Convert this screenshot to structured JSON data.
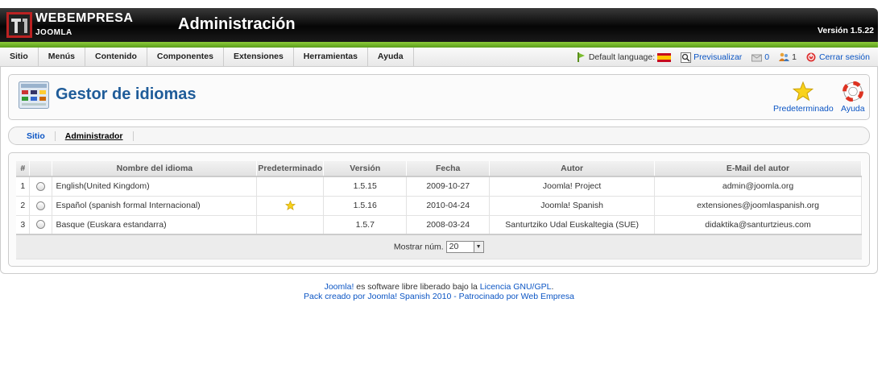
{
  "header": {
    "logo_title": "WEBEMPRESA",
    "logo_sub": "JOOMLA",
    "title": "Administración",
    "version": "Versión 1.5.22"
  },
  "menu": [
    "Sitio",
    "Menús",
    "Contenido",
    "Componentes",
    "Extensiones",
    "Herramientas",
    "Ayuda"
  ],
  "status": {
    "default_language": "Default language:",
    "preview": "Previsualizar",
    "messages": "0",
    "users": "1",
    "logout": "Cerrar sesión"
  },
  "toolbar": {
    "title": "Gestor de idiomas",
    "default_button": "Predeterminado",
    "help_button": "Ayuda"
  },
  "submenu": [
    "Sitio",
    "Administrador"
  ],
  "table": {
    "headers": [
      "#",
      "",
      "Nombre del idioma",
      "Predeterminado",
      "Versión",
      "Fecha",
      "Autor",
      "E-Mail del autor"
    ],
    "rows": [
      {
        "num": "1",
        "name": "English(United Kingdom)",
        "default": false,
        "version": "1.5.15",
        "date": "2009-10-27",
        "author": "Joomla! Project",
        "email": "admin@joomla.org"
      },
      {
        "num": "2",
        "name": "Español (spanish formal Internacional)",
        "default": true,
        "version": "1.5.16",
        "date": "2010-04-24",
        "author": "Joomla! Spanish",
        "email": "extensiones@joomlaspanish.org"
      },
      {
        "num": "3",
        "name": "Basque (Euskara estandarra)",
        "default": false,
        "version": "1.5.7",
        "date": "2008-03-24",
        "author": "Santurtziko Udal Euskaltegia (SUE)",
        "email": "didaktika@santurtzieus.com"
      }
    ],
    "display_label": "Mostrar núm.",
    "display_value": "20"
  },
  "footer": {
    "line1_link": "Joomla!",
    "line1_text": " es software libre liberado bajo la ",
    "line1_license": "Licencia GNU/GPL",
    "line1_end": ".",
    "line2": "Pack creado por Joomla! Spanish 2010 - Patrocinado por Web Empresa"
  },
  "colors": {
    "header_bg": "#000000",
    "accent_green": "#7bbd2f",
    "link_blue": "#0b55c4",
    "title_blue": "#1f5c99"
  }
}
